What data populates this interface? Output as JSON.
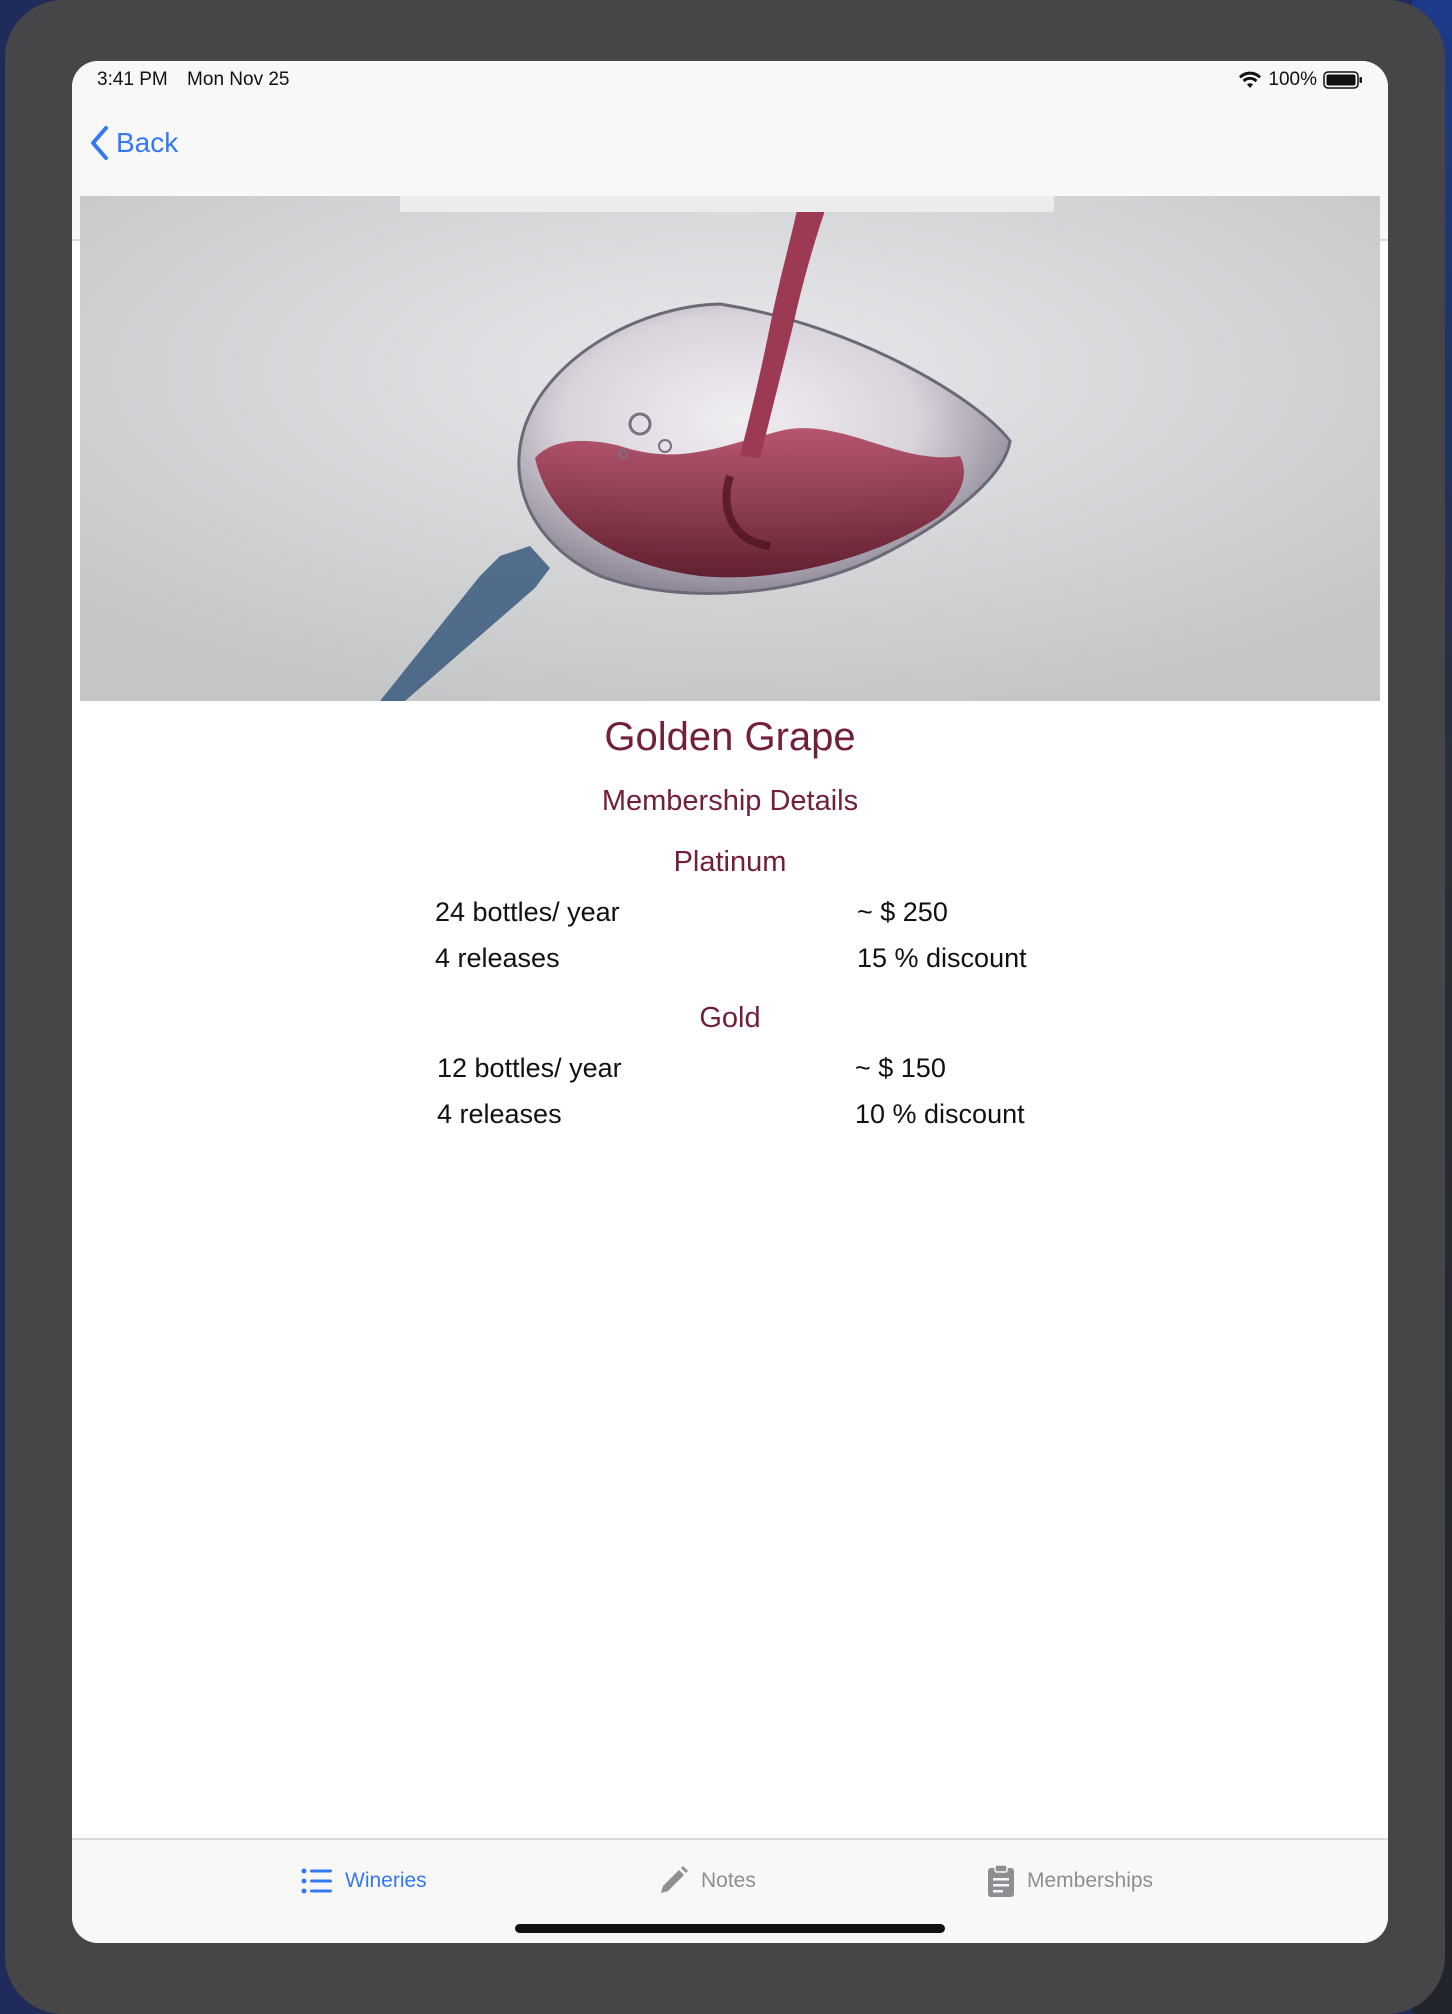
{
  "status_bar": {
    "time": "3:41 PM",
    "date": "Mon Nov 25",
    "battery": "100%"
  },
  "nav": {
    "back_label": "Back"
  },
  "hero": {
    "icon": "wine-glass-photo"
  },
  "winery": {
    "name": "Golden Grape",
    "section_title": "Membership Details"
  },
  "tiers": [
    {
      "name": "Platinum",
      "bottles": "24 bottles/ year",
      "price": "~ $ 250",
      "releases": "4 releases",
      "discount": "15 % discount"
    },
    {
      "name": "Gold",
      "bottles": "12 bottles/ year",
      "price": "~ $ 150",
      "releases": "4 releases",
      "discount": "10 % discount"
    }
  ],
  "tabs": [
    {
      "label": "Wineries",
      "icon": "list-icon",
      "active": true
    },
    {
      "label": "Notes",
      "icon": "pencil-icon",
      "active": false
    },
    {
      "label": "Memberships",
      "icon": "clipboard-icon",
      "active": false
    }
  ],
  "colors": {
    "accent": "#3478f6",
    "title": "#722038",
    "inactive": "#8e8e93"
  }
}
